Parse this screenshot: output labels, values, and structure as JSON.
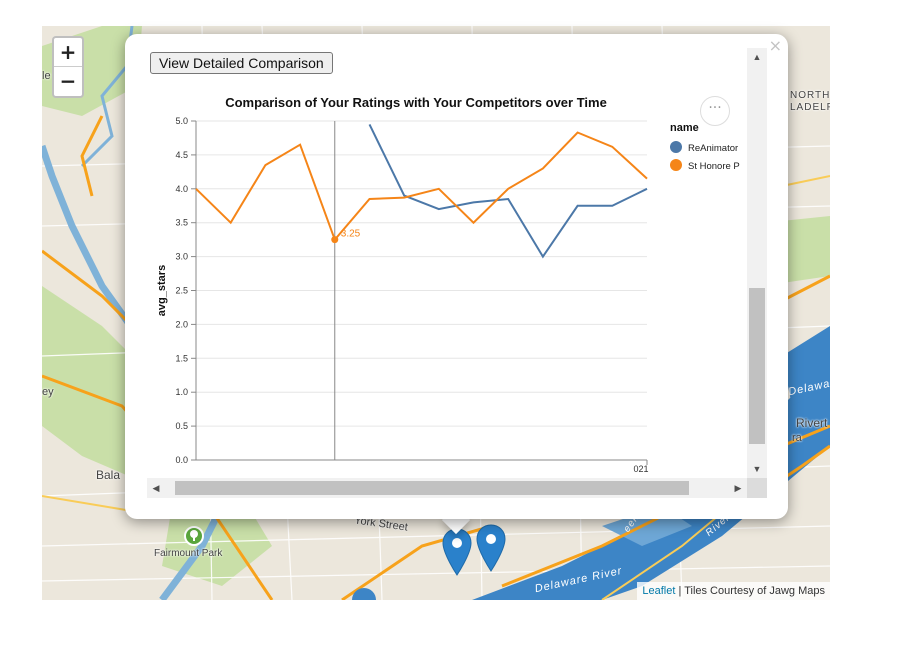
{
  "map": {
    "zoom_in_label": "+",
    "zoom_out_label": "−",
    "labels": {
      "north": "NORTH",
      "philadelphia": "LADELP",
      "bala": "Bala",
      "fairmount_park": "Fairmount Park",
      "york_street": "York Street",
      "delaware_river": "Delaware River",
      "delaware_right": "Delawa",
      "riverton": "Rivert",
      "ra": "ra",
      "river": "River",
      "creek": "eek",
      "le": "le",
      "ey": "ey"
    },
    "attribution": {
      "leaflet": "Leaflet",
      "separator": " | ",
      "tiles": "Tiles Courtesy of Jawg Maps"
    },
    "colors": {
      "water": "#7fb2d8",
      "river": "#3d85c6",
      "roads": "#f7a21b",
      "parks": "#c9dfa8",
      "marker": "#2a81cb"
    },
    "icons": {
      "marker": "map-marker-icon",
      "park": "tree-icon"
    }
  },
  "popup": {
    "close_label": "×",
    "button_label": "View Detailed Comparison",
    "actions_label": "···",
    "scroll_up": "▲",
    "scroll_down": "▼",
    "scroll_left": "◀",
    "scroll_right": "▶"
  },
  "chart_data": {
    "type": "line",
    "title": "Comparison of Your Ratings with Your Competitors over Time",
    "xlabel": "",
    "ylabel": "avg_stars",
    "ylim": [
      0,
      5
    ],
    "yticks": [
      "0.0",
      "0.5",
      "1.0",
      "1.5",
      "2.0",
      "2.5",
      "3.0",
      "3.5",
      "4.0",
      "4.5",
      "5.0"
    ],
    "visible_x_tick_label": "021",
    "legend_title": "name",
    "legend_position": "right",
    "grid": true,
    "x_index": [
      0,
      1,
      2,
      3,
      4,
      5,
      6,
      7,
      8,
      9,
      10,
      11,
      12,
      13
    ],
    "series": [
      {
        "name": "ReAnimator",
        "color": "#4c78a8",
        "values": [
          null,
          null,
          null,
          null,
          null,
          4.95,
          3.9,
          3.7,
          3.8,
          3.85,
          3.0,
          3.75,
          3.75,
          4.0
        ]
      },
      {
        "name": "St Honore P",
        "color": "#f58518",
        "values": [
          4.0,
          3.5,
          4.35,
          4.65,
          3.25,
          3.85,
          3.87,
          4.0,
          3.5,
          4.0,
          4.3,
          4.83,
          4.62,
          4.15
        ]
      }
    ],
    "tooltip": {
      "x_index": 4,
      "label": "3.25"
    }
  }
}
